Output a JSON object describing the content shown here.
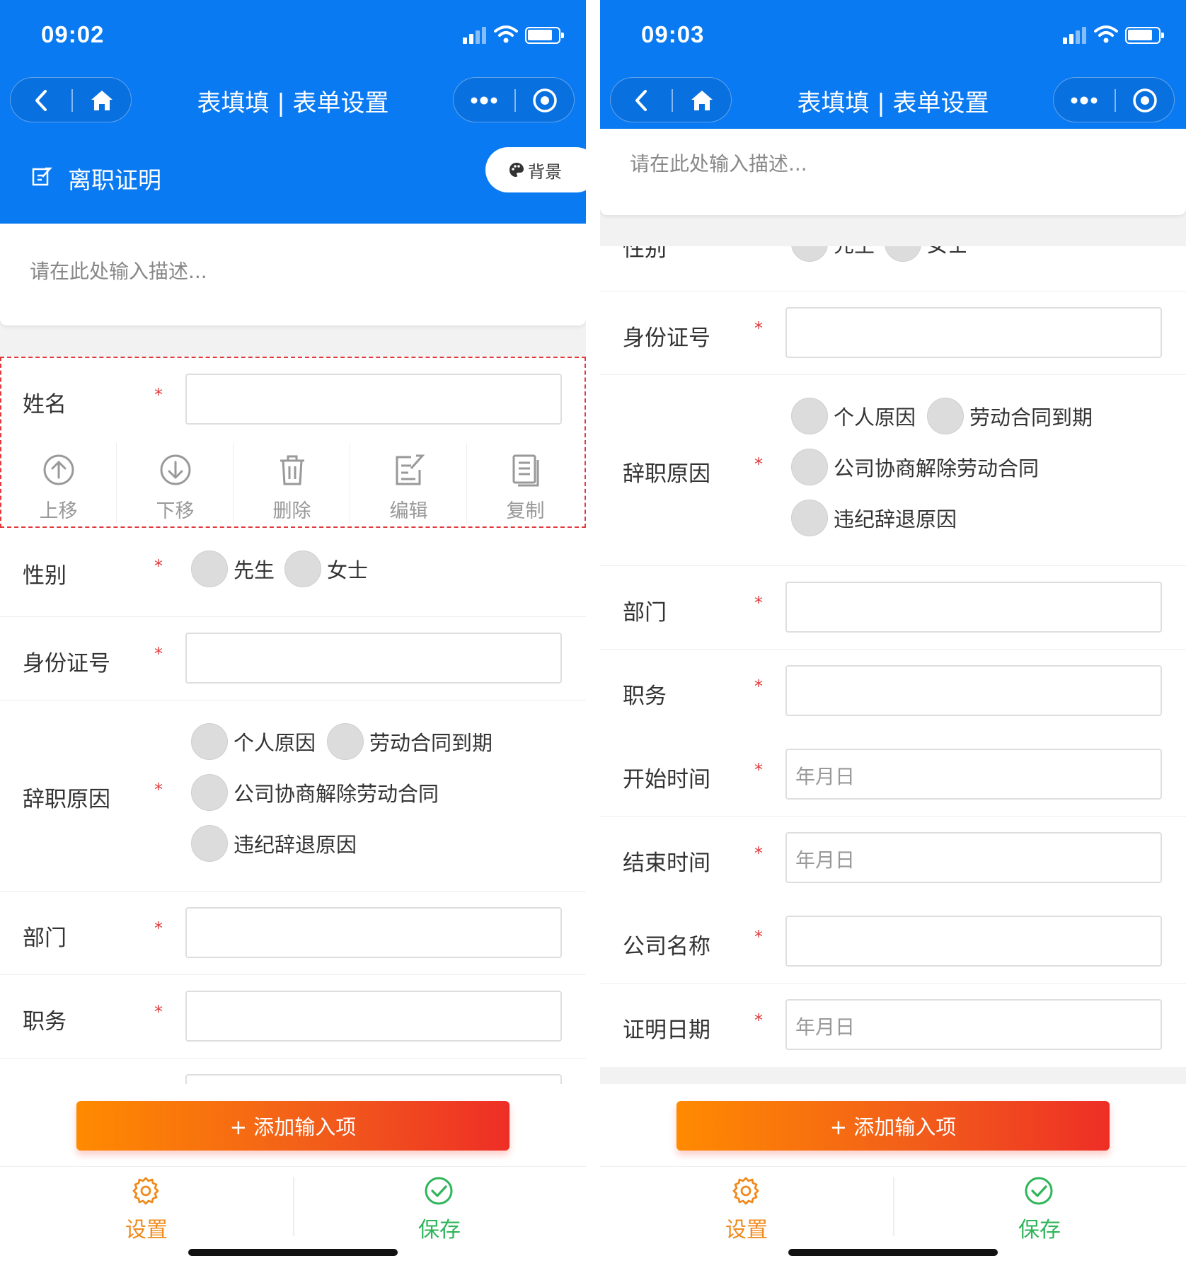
{
  "left": {
    "status_time": "09:02",
    "nav_title": "表填填 | 表单设置",
    "form_title": "离职证明",
    "bg_button": "背景",
    "description_placeholder": "请在此处输入描述...",
    "fields": {
      "name": "姓名",
      "gender": "性别",
      "id_number": "身份证号",
      "reason": "辞职原因",
      "department": "部门",
      "position": "职务"
    },
    "required_mark": "*",
    "gender_options": [
      "先生",
      "女士"
    ],
    "reason_options": [
      "个人原因",
      "劳动合同到期",
      "公司协商解除劳动合同",
      "违纪辞退原因"
    ],
    "actions": [
      "上移",
      "下移",
      "删除",
      "编辑",
      "复制"
    ],
    "add_button": "+ 添加输入项",
    "tab_settings": "设置",
    "tab_save": "保存"
  },
  "right": {
    "status_time": "09:03",
    "nav_title": "表填填 | 表单设置",
    "description_placeholder": "请在此处输入描述...",
    "fields": {
      "gender_partial": "性别",
      "id_number": "身份证号",
      "reason": "辞职原因",
      "department": "部门",
      "position": "职务",
      "start_time": "开始时间",
      "end_time": "结束时间",
      "company_name": "公司名称",
      "certificate_date": "证明日期"
    },
    "required_mark": "*",
    "gender_options_partial": [
      "先生",
      "女士"
    ],
    "reason_options": [
      "个人原因",
      "劳动合同到期",
      "公司协商解除劳动合同",
      "违纪辞退原因"
    ],
    "date_placeholder": "年月日",
    "add_button": "+ 添加输入项",
    "tab_settings": "设置",
    "tab_save": "保存"
  },
  "colors": {
    "header_blue": "#0A7AF2",
    "required_red": "#E4393C",
    "add_gradient_start": "#FF8A00",
    "add_gradient_end": "#EE2E26",
    "settings_orange": "#F08A1C",
    "save_green": "#2EB55A"
  },
  "icons": [
    "back-icon",
    "home-icon",
    "more-icon",
    "target-icon",
    "edit-form-icon",
    "palette-icon",
    "move-up-icon",
    "move-down-icon",
    "trash-icon",
    "edit-icon",
    "copy-icon",
    "gear-icon",
    "check-circle-icon"
  ]
}
